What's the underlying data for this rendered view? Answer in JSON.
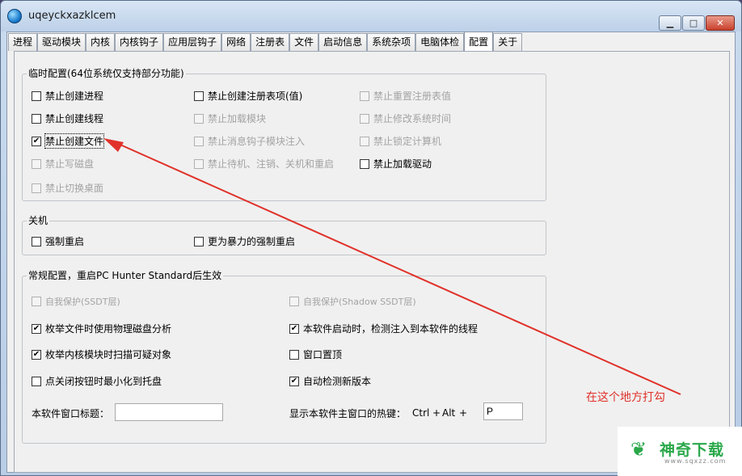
{
  "window": {
    "title": "uqeyckxazklcem",
    "minimize_glyph": "▁",
    "maximize_glyph": "□",
    "close_glyph": "✕"
  },
  "tabs": [
    "进程",
    "驱动模块",
    "内核",
    "内核钩子",
    "应用层钩子",
    "网络",
    "注册表",
    "文件",
    "启动信息",
    "系统杂项",
    "电脑体检",
    "配置",
    "关于"
  ],
  "active_tab": "配置",
  "temp_config": {
    "title": "临时配置(64位系统仅支持部分功能)",
    "items": [
      {
        "label": "禁止创建进程",
        "checked": false,
        "enabled": true
      },
      {
        "label": "禁止创建注册表项(值)",
        "checked": false,
        "enabled": true
      },
      {
        "label": "禁止重置注册表值",
        "checked": false,
        "enabled": false
      },
      {
        "label": "禁止创建线程",
        "checked": false,
        "enabled": true
      },
      {
        "label": "禁止加载模块",
        "checked": false,
        "enabled": false
      },
      {
        "label": "禁止修改系统时间",
        "checked": false,
        "enabled": false
      },
      {
        "label": "禁止创建文件",
        "checked": true,
        "enabled": true
      },
      {
        "label": "禁止消息钩子模块注入",
        "checked": false,
        "enabled": false
      },
      {
        "label": "禁止锁定计算机",
        "checked": false,
        "enabled": false
      },
      {
        "label": "禁止写磁盘",
        "checked": false,
        "enabled": false
      },
      {
        "label": "禁止待机、注销、关机和重启",
        "checked": false,
        "enabled": false
      },
      {
        "label": "禁止加载驱动",
        "checked": false,
        "enabled": true
      },
      {
        "label": "禁止切换桌面",
        "checked": false,
        "enabled": false
      }
    ]
  },
  "shutdown": {
    "title": "关机",
    "items": [
      {
        "label": "强制重启",
        "checked": false,
        "enabled": true
      },
      {
        "label": "更为暴力的强制重启",
        "checked": false,
        "enabled": true
      }
    ]
  },
  "general": {
    "title": "常规配置，重启PC Hunter Standard后生效",
    "items": [
      {
        "label": "自我保护(SSDT层)",
        "checked": false,
        "enabled": false
      },
      {
        "label": "自我保护(Shadow SSDT层)",
        "checked": false,
        "enabled": false
      },
      {
        "label": "枚举文件时使用物理磁盘分析",
        "checked": true,
        "enabled": true
      },
      {
        "label": "本软件启动时，检测注入到本软件的线程",
        "checked": true,
        "enabled": true
      },
      {
        "label": "枚举内核模块时扫描可疑对象",
        "checked": true,
        "enabled": true
      },
      {
        "label": "窗口置顶",
        "checked": false,
        "enabled": true
      },
      {
        "label": "点关闭按钮时最小化到托盘",
        "checked": false,
        "enabled": true
      },
      {
        "label": "自动检测新版本",
        "checked": true,
        "enabled": true
      }
    ],
    "window_title_label": "本软件窗口标题：",
    "window_title_value": "",
    "hotkey_label": "显示本软件主窗口的热键：",
    "hotkey_ctrl": "Ctrl",
    "hotkey_plus1": "+",
    "hotkey_alt": "Alt",
    "hotkey_plus2": "+",
    "hotkey_value": "P"
  },
  "annotation": {
    "text": "在这个地方打勾",
    "color": "#e0322a"
  },
  "watermark": {
    "brand": "神奇下载",
    "url": "www.sqxzz.com",
    "mark": "❦"
  },
  "colors": {
    "accent_green": "#2aa84a",
    "disabled_text": "#a3a3a3"
  }
}
